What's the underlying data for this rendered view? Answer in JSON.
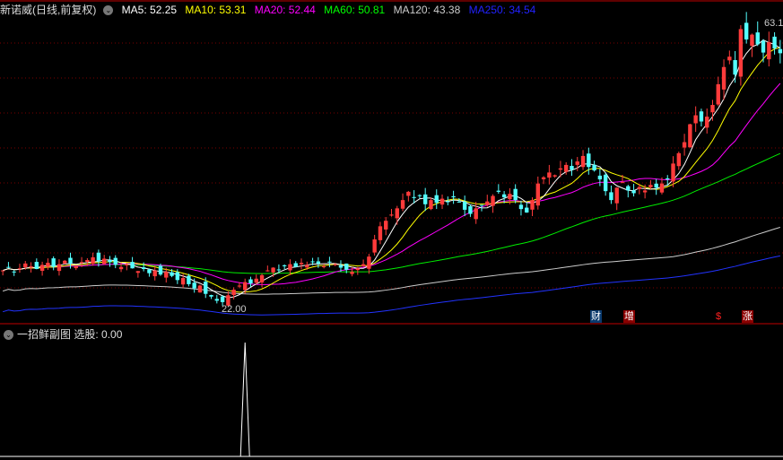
{
  "header": {
    "title": "新诺威(日线,前复权)",
    "ma": [
      {
        "label": "MA5: 52.25",
        "color": "#ffffff"
      },
      {
        "label": "MA10: 53.31",
        "color": "#ffff00"
      },
      {
        "label": "MA20: 52.44",
        "color": "#ff00ff"
      },
      {
        "label": "MA60: 50.81",
        "color": "#00ff00"
      },
      {
        "label": "MA120: 43.38",
        "color": "#cccccc"
      },
      {
        "label": "MA250: 34.54",
        "color": "#0000ff"
      }
    ]
  },
  "labels": {
    "low": "22.00",
    "high": "63.1"
  },
  "badges": [
    {
      "text": "财",
      "bg": "#0a3a6e",
      "color": "#fff"
    },
    {
      "text": "增",
      "bg": "#8b0000",
      "color": "#fff"
    },
    {
      "text": "$",
      "bg": "transparent",
      "color": "#ff2020"
    },
    {
      "text": "涨",
      "bg": "#8b0000",
      "color": "#fff"
    }
  ],
  "sub": {
    "title": "一招鲜副图",
    "value_label": "选股: 0.00"
  },
  "colors": {
    "up": "#ff3b3b",
    "down": "#54ffff",
    "divider": "#c00000"
  },
  "chart_data": {
    "type": "candlestick",
    "price_range": [
      22.0,
      63.1
    ],
    "closes": [
      27,
      27.5,
      26.8,
      27.3,
      28,
      27.6,
      27.2,
      27.8,
      28.1,
      27.5,
      27.9,
      28.4,
      28,
      27.6,
      28.2,
      28.5,
      28.9,
      28.3,
      28.7,
      28.2,
      27.8,
      27.5,
      27.9,
      27.3,
      26.9,
      27.2,
      26.6,
      27,
      26.4,
      26.8,
      26.2,
      25.6,
      25.9,
      25,
      24.4,
      24.8,
      23.6,
      23.2,
      22.6,
      22.4,
      23.4,
      24.2,
      24.8,
      25.3,
      25.1,
      25.8,
      26.3,
      27,
      27.4,
      27.1,
      27.6,
      27.9,
      27.5,
      28.1,
      27.8,
      28.3,
      28,
      27.6,
      28.2,
      27.9,
      27.4,
      27.1,
      26.8,
      27.3,
      27.9,
      29,
      31.5,
      33.4,
      34.2,
      35.1,
      36,
      37.2,
      38.4,
      37.5,
      37.8,
      36.6,
      37.2,
      36.8,
      37.4,
      37,
      37.6,
      36.9,
      35.8,
      35.2,
      36,
      36.4,
      37,
      37.8,
      38.4,
      37.6,
      38.1,
      37.2,
      35.9,
      35.4,
      37.2,
      39.6,
      40.5,
      41.2,
      40.8,
      41.8,
      42.3,
      41.6,
      42.8,
      43.6,
      42,
      41.5,
      40.2,
      38.5,
      37.2,
      39,
      39.8,
      38.6,
      38.2,
      39.1,
      38.6,
      39.4,
      39,
      39.6,
      40.2,
      42.5,
      44,
      45.6,
      48.2,
      49.5,
      48.6,
      49.3,
      51,
      54,
      56.5,
      58,
      55.4,
      62,
      60.5,
      61.2,
      59.8,
      58.6,
      60.1,
      59.2,
      58.5
    ],
    "sub_signal": {
      "name": "选股",
      "index": 43,
      "value": 1
    }
  }
}
